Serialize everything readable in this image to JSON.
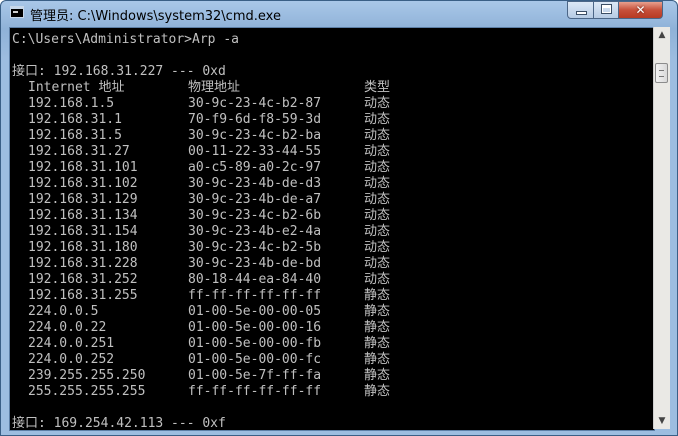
{
  "window": {
    "title": "管理员: C:\\Windows\\system32\\cmd.exe",
    "close_symbol": "✕"
  },
  "console": {
    "command_line": "C:\\Users\\Administrator>Arp -a",
    "interface1": "接口: 192.168.31.227 --- 0xd",
    "headers": {
      "internet": "Internet 地址",
      "physical": "物理地址",
      "type": "类型"
    },
    "entries": [
      {
        "ip": "192.168.1.5",
        "mac": "30-9c-23-4c-b2-87",
        "type": "动态"
      },
      {
        "ip": "192.168.31.1",
        "mac": "70-f9-6d-f8-59-3d",
        "type": "动态"
      },
      {
        "ip": "192.168.31.5",
        "mac": "30-9c-23-4c-b2-ba",
        "type": "动态"
      },
      {
        "ip": "192.168.31.27",
        "mac": "00-11-22-33-44-55",
        "type": "动态"
      },
      {
        "ip": "192.168.31.101",
        "mac": "a0-c5-89-a0-2c-97",
        "type": "动态"
      },
      {
        "ip": "192.168.31.102",
        "mac": "30-9c-23-4b-de-d3",
        "type": "动态"
      },
      {
        "ip": "192.168.31.129",
        "mac": "30-9c-23-4b-de-a7",
        "type": "动态"
      },
      {
        "ip": "192.168.31.134",
        "mac": "30-9c-23-4c-b2-6b",
        "type": "动态"
      },
      {
        "ip": "192.168.31.154",
        "mac": "30-9c-23-4b-e2-4a",
        "type": "动态"
      },
      {
        "ip": "192.168.31.180",
        "mac": "30-9c-23-4c-b2-5b",
        "type": "动态"
      },
      {
        "ip": "192.168.31.228",
        "mac": "30-9c-23-4b-de-bd",
        "type": "动态"
      },
      {
        "ip": "192.168.31.252",
        "mac": "80-18-44-ea-84-40",
        "type": "动态"
      },
      {
        "ip": "192.168.31.255",
        "mac": "ff-ff-ff-ff-ff-ff",
        "type": "静态"
      },
      {
        "ip": "224.0.0.5",
        "mac": "01-00-5e-00-00-05",
        "type": "静态"
      },
      {
        "ip": "224.0.0.22",
        "mac": "01-00-5e-00-00-16",
        "type": "静态"
      },
      {
        "ip": "224.0.0.251",
        "mac": "01-00-5e-00-00-fb",
        "type": "静态"
      },
      {
        "ip": "224.0.0.252",
        "mac": "01-00-5e-00-00-fc",
        "type": "静态"
      },
      {
        "ip": "239.255.255.250",
        "mac": "01-00-5e-7f-ff-fa",
        "type": "静态"
      },
      {
        "ip": "255.255.255.255",
        "mac": "ff-ff-ff-ff-ff-ff",
        "type": "静态"
      }
    ],
    "interface2": "接口: 169.254.42.113 --- 0xf"
  },
  "scrollbar": {
    "up_arrow": "▲",
    "down_arrow": "▼"
  }
}
